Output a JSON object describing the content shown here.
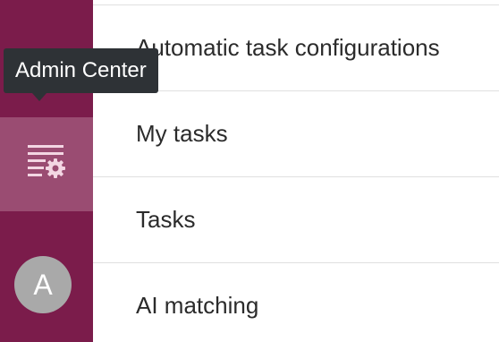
{
  "tooltip": {
    "text": "Admin Center"
  },
  "sidebar": {
    "active_item_icon": "admin-settings-list-icon",
    "avatar_initial": "A",
    "colors": {
      "sidebar_bg": "#7b1c4b",
      "active_bg": "#9a4c72",
      "avatar_bg": "#a9a9a9"
    }
  },
  "menu": {
    "items": [
      {
        "label": "Automatic task configurations"
      },
      {
        "label": "My tasks"
      },
      {
        "label": "Tasks"
      },
      {
        "label": "AI matching"
      }
    ]
  }
}
